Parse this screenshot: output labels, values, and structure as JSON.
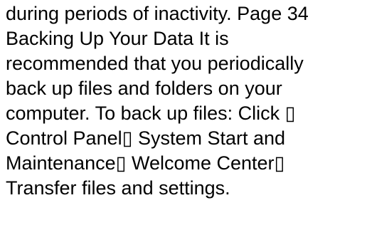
{
  "document": {
    "lines": [
      "during periods of inactivity. Page 34",
      "Backing Up Your Data It is",
      "recommended that you periodically",
      "back up files and folders on your",
      "computer. To back up files: Click ▯",
      "Control Panel▯ System Start and",
      "Maintenance▯ Welcome Center▯",
      "Transfer files and settings."
    ]
  }
}
